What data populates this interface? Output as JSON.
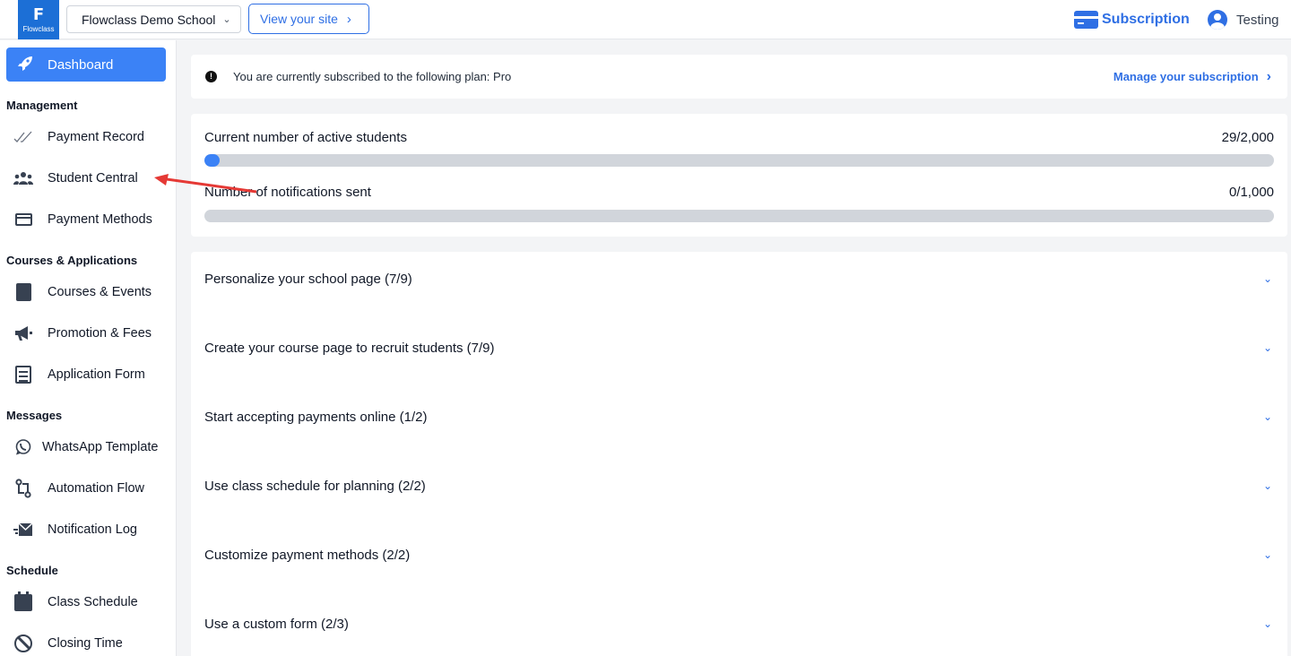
{
  "header": {
    "logo_text": "Flowclass",
    "school_name": "Flowclass Demo School",
    "view_site_label": "View your site",
    "subscription_label": "Subscription",
    "user_name": "Testing"
  },
  "sidebar": {
    "dashboard_label": "Dashboard",
    "sections": {
      "management": "Management",
      "courses": "Courses & Applications",
      "messages": "Messages",
      "schedule": "Schedule"
    },
    "items": {
      "payment_record": "Payment Record",
      "student_central": "Student Central",
      "payment_methods": "Payment Methods",
      "courses_events": "Courses & Events",
      "promotion_fees": "Promotion & Fees",
      "application_form": "Application Form",
      "whatsapp_template": "WhatsApp Template",
      "automation_flow": "Automation Flow",
      "notification_log": "Notification Log",
      "class_schedule": "Class Schedule",
      "closing_time": "Closing Time"
    }
  },
  "banner": {
    "text": "You are currently subscribed to the following plan: Pro",
    "manage_link": "Manage your subscription"
  },
  "usage": [
    {
      "label": "Current number of active students",
      "value": "29/2,000",
      "fraction": 0.0145
    },
    {
      "label": "Number of notifications sent",
      "value": "0/1,000",
      "fraction": 0
    }
  ],
  "tasks": [
    "Personalize your school page (7/9)",
    "Create your course page to recruit students (7/9)",
    "Start accepting payments online (1/2)",
    "Use class schedule for planning (2/2)",
    "Customize payment methods (2/2)",
    "Use a custom form (2/3)"
  ],
  "colors": {
    "accent": "#2f6fe4",
    "active_nav": "#3b82f6",
    "bar_track": "#d1d5db",
    "annotation_arrow": "#e53935"
  }
}
